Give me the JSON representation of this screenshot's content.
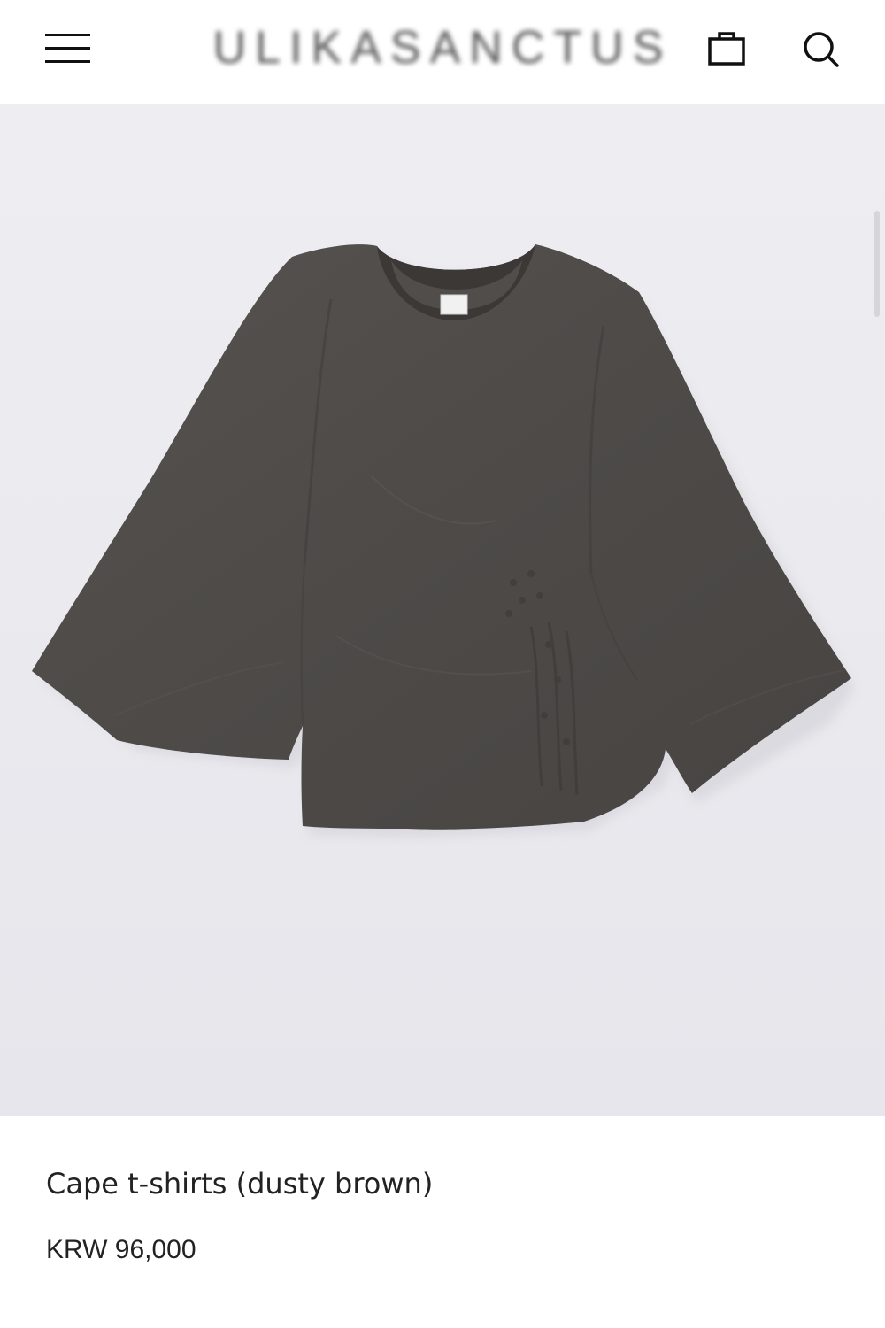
{
  "header": {
    "logo_text": "ULIKASANCTUS",
    "menu_icon": "hamburger-menu-icon",
    "cart_icon": "shopping-bag-icon",
    "search_icon": "search-icon"
  },
  "product": {
    "title": "Cape t-shirts (dusty brown)",
    "price": "KRW 96,000",
    "garment_color": "#4e4b49",
    "collar_color": "#3a3735"
  },
  "colors": {
    "background": "#ffffff",
    "text": "#222222",
    "photo_background": "#ececf0"
  }
}
